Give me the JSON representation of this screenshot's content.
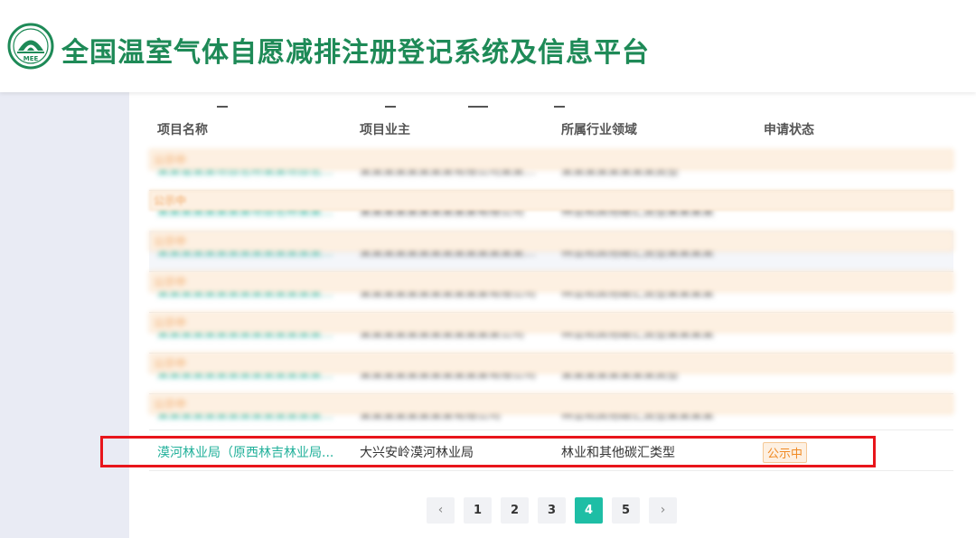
{
  "header": {
    "title": "全国温室气体自愿减排注册登记系统及信息平台",
    "logo_text": "MEE"
  },
  "table": {
    "columns": [
      "项目名称",
      "项目业主",
      "所属行业领域",
      "申请状态"
    ],
    "blurred_rows": [
      {
        "name": "某某省某某项目名称某某项目名称某某",
        "owner": "某某某某某某某某有限公司某某某某",
        "industry": "某某某某某某某某类型",
        "status": "公示中"
      },
      {
        "name": "某某某某某某某某项目名称某某某某",
        "owner": "某某某某某某某某某某有限公司",
        "industry": "林业和其他碳汇类型某某某某",
        "status": "公示中"
      },
      {
        "name": "某某某某某某某某某某某某某某项目",
        "owner": "某某某某某某某某某某某某某某公司",
        "industry": "林业和其他碳汇类型某某某某",
        "status": "公示中"
      },
      {
        "name": "某某某某某某某某某某某某某某项目",
        "owner": "某某某某某某某某某某某有限公司",
        "industry": "林业和其他碳汇类型某某某某",
        "status": "公示中"
      },
      {
        "name": "某某某某某某某某某某某某某某项目",
        "owner": "某某某某某某某某某某某某公司",
        "industry": "林业和其他碳汇类型某某某某",
        "status": "公示中"
      },
      {
        "name": "某某某某某某某某某某某某某某项目",
        "owner": "某某某某某某某某某某某有限公司",
        "industry": "某某某某某某某某类型",
        "status": "公示中"
      },
      {
        "name": "某某某某某某某某某某某某某某项目",
        "owner": "某某某某某某某某有限公司",
        "industry": "林业和其他碳汇类型某某某某",
        "status": "公示中"
      }
    ],
    "highlighted_row": {
      "name": "漠河林业局（原西林吉林业局...",
      "owner": "大兴安岭漠河林业局",
      "industry": "林业和其他碳汇类型",
      "status": "公示中"
    }
  },
  "pagination": {
    "prev": "‹",
    "pages": [
      "1",
      "2",
      "3",
      "4",
      "5"
    ],
    "current": "4",
    "next": "›"
  },
  "colors": {
    "brand_green": "#1e8a57",
    "link_teal": "#21b09a",
    "active_page": "#1ebea5",
    "status_orange": "#f08a24",
    "highlight_red": "#e8151b"
  }
}
